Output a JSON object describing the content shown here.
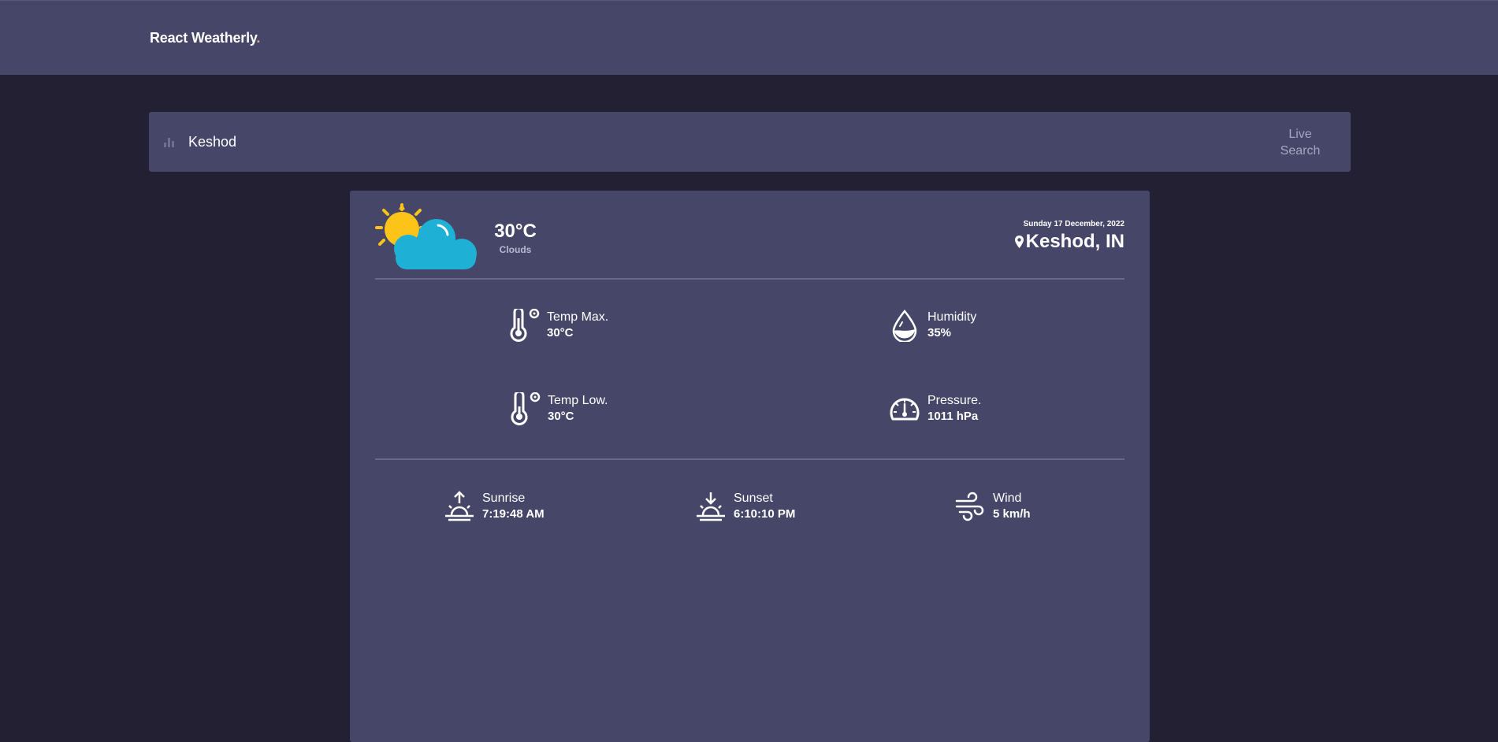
{
  "app": {
    "brand": "React Weatherly",
    "brand_dot": "."
  },
  "search": {
    "value": "Keshod",
    "live_label": "Live Search"
  },
  "current": {
    "icon": "sun-behind-cloud-icon",
    "temperature": "30°C",
    "description": "Clouds",
    "date": "Sunday 17 December, 2022",
    "location": "Keshod, IN"
  },
  "details": {
    "temp_max": {
      "label": "Temp Max.",
      "value": "30°C",
      "icon": "thermometer-icon"
    },
    "humidity": {
      "label": "Humidity",
      "value": "35%",
      "icon": "water-drop-icon"
    },
    "temp_low": {
      "label": "Temp Low.",
      "value": "30°C",
      "icon": "thermometer-icon"
    },
    "pressure": {
      "label": "Pressure.",
      "value": "1011 hPa",
      "icon": "gauge-icon"
    }
  },
  "extras": {
    "sunrise": {
      "label": "Sunrise",
      "value": "7:19:48 AM",
      "icon": "sunrise-icon"
    },
    "sunset": {
      "label": "Sunset",
      "value": "6:10:10 PM",
      "icon": "sunset-icon"
    },
    "wind": {
      "label": "Wind",
      "value": "5 km/h",
      "icon": "wind-icon"
    }
  },
  "colors": {
    "background": "#222032",
    "panel": "#464669",
    "sun": "#fcc419",
    "cloud": "#1eb0d5"
  }
}
